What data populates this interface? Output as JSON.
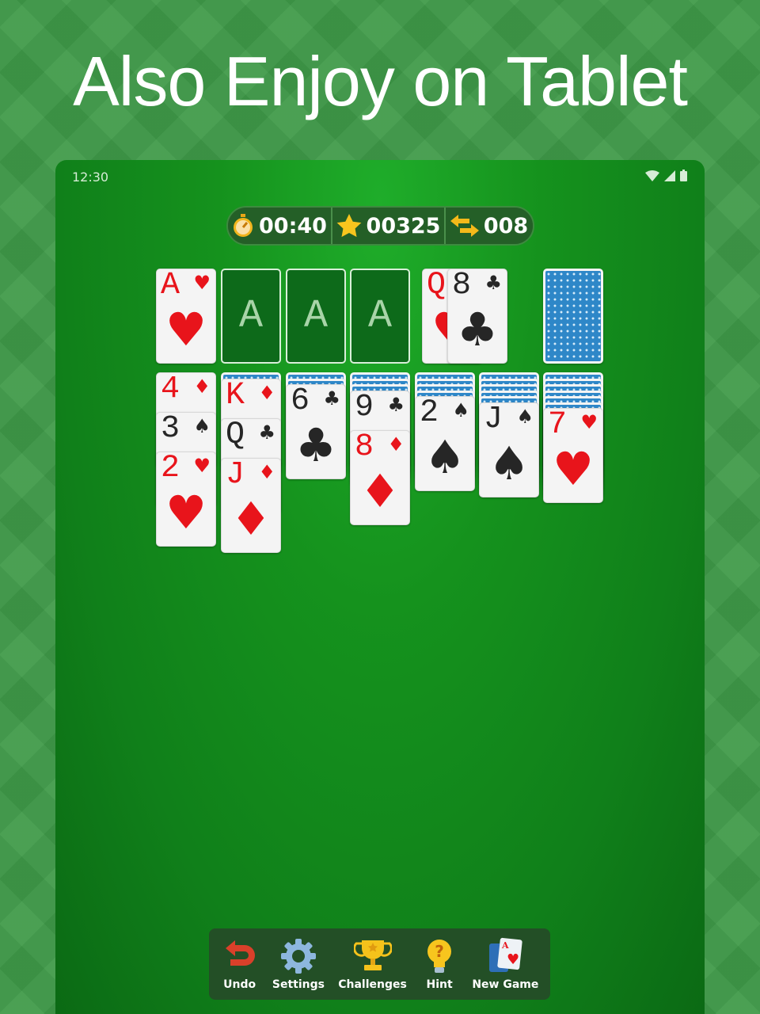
{
  "headline": "Also Enjoy on Tablet",
  "status_bar": {
    "time": "12:30",
    "icons": [
      "wifi-icon",
      "signal-icon",
      "battery-icon"
    ]
  },
  "stats": {
    "time": "00:40",
    "score": "00325",
    "moves": "008"
  },
  "foundations": [
    {
      "rank": "A",
      "suit": "♥",
      "color": "red"
    },
    {
      "placeholder": "A"
    },
    {
      "placeholder": "A"
    },
    {
      "placeholder": "A"
    }
  ],
  "waste": [
    {
      "rank": "Q",
      "suit": "♥",
      "color": "red"
    },
    {
      "rank": "8",
      "suit": "♣",
      "color": "black"
    }
  ],
  "stock": {
    "face_down": true
  },
  "tableau": [
    {
      "face_down": 0,
      "cards": [
        {
          "rank": "4",
          "suit": "♦",
          "color": "red"
        },
        {
          "rank": "3",
          "suit": "♠",
          "color": "black"
        },
        {
          "rank": "2",
          "suit": "♥",
          "color": "red"
        }
      ]
    },
    {
      "face_down": 1,
      "cards": [
        {
          "rank": "K",
          "suit": "♦",
          "color": "red"
        },
        {
          "rank": "Q",
          "suit": "♣",
          "color": "black"
        },
        {
          "rank": "J",
          "suit": "♦",
          "color": "red"
        }
      ]
    },
    {
      "face_down": 2,
      "cards": [
        {
          "rank": "6",
          "suit": "♣",
          "color": "black"
        }
      ]
    },
    {
      "face_down": 3,
      "cards": [
        {
          "rank": "9",
          "suit": "♣",
          "color": "black"
        },
        {
          "rank": "8",
          "suit": "♦",
          "color": "red"
        }
      ]
    },
    {
      "face_down": 4,
      "cards": [
        {
          "rank": "2",
          "suit": "♠",
          "color": "black"
        }
      ]
    },
    {
      "face_down": 5,
      "cards": [
        {
          "rank": "J",
          "suit": "♠",
          "color": "black"
        }
      ]
    },
    {
      "face_down": 6,
      "cards": [
        {
          "rank": "7",
          "suit": "♥",
          "color": "red"
        }
      ]
    }
  ],
  "toolbar": {
    "undo": "Undo",
    "settings": "Settings",
    "challenges": "Challenges",
    "hint": "Hint",
    "new_game": "New Game"
  }
}
